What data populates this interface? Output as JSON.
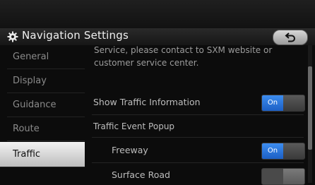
{
  "header": {
    "title": "Navigation Settings",
    "gear_icon": "gear-icon",
    "back_icon": "back-arrow-icon"
  },
  "sidebar": {
    "items": [
      {
        "label": "General",
        "active": false
      },
      {
        "label": "Display",
        "active": false
      },
      {
        "label": "Guidance",
        "active": false
      },
      {
        "label": "Route",
        "active": false
      },
      {
        "label": "Traffic",
        "active": true
      }
    ]
  },
  "content": {
    "notice": "Service, please contact to SXM website or customer service center.",
    "rows": [
      {
        "label": "Show Traffic Information",
        "toggle": "On"
      },
      {
        "label": "Traffic Event Popup"
      },
      {
        "label": "Freeway",
        "toggle": "On"
      },
      {
        "label": "Surface Road",
        "toggle": "Off"
      }
    ]
  },
  "colors": {
    "accent": "#2f7fe8",
    "background": "#0c0c0c",
    "active_tab": "#e0e0e0"
  }
}
